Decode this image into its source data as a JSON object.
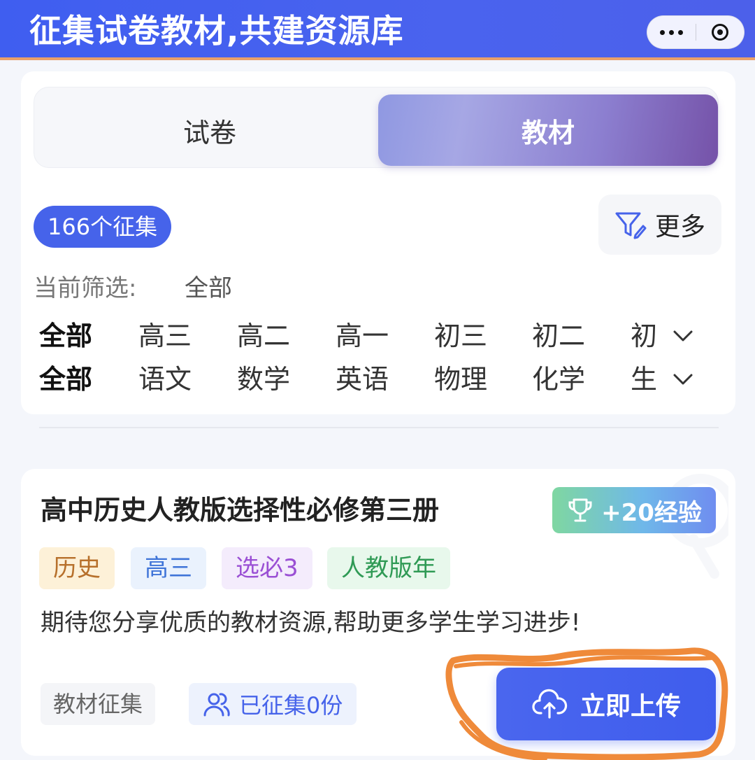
{
  "header": {
    "title": "征集试卷教材,共建资源库"
  },
  "mini_program_capsule": {
    "more_icon": "more-dots-icon",
    "close_icon": "target-circle-icon"
  },
  "tabs": [
    {
      "label": "试卷",
      "active": false
    },
    {
      "label": "教材",
      "active": true
    }
  ],
  "count_badge": "166个征集",
  "more_filter": {
    "label": "更多",
    "icon": "funnel-edit-icon"
  },
  "current_filter": {
    "label": "当前筛选:",
    "value": "全部"
  },
  "grade_filters": [
    "全部",
    "高三",
    "高二",
    "高一",
    "初三",
    "初二",
    "初一"
  ],
  "subject_filters": [
    "全部",
    "语文",
    "数学",
    "英语",
    "物理",
    "化学",
    "生物"
  ],
  "task_card": {
    "title": "高中历史人教版选择性必修第三册",
    "reward": "+20经验",
    "tags": [
      "历史",
      "高三",
      "选必3",
      "人教版年"
    ],
    "description": "期待您分享优质的教材资源,帮助更多学生学习进步!",
    "category": "教材征集",
    "collected": "已征集0份",
    "upload_label": "立即上传"
  },
  "colors": {
    "primary": "#4663ea",
    "active_tab_gradient_end": "#7552a8",
    "annotation_orange": "#ef8a3a"
  }
}
